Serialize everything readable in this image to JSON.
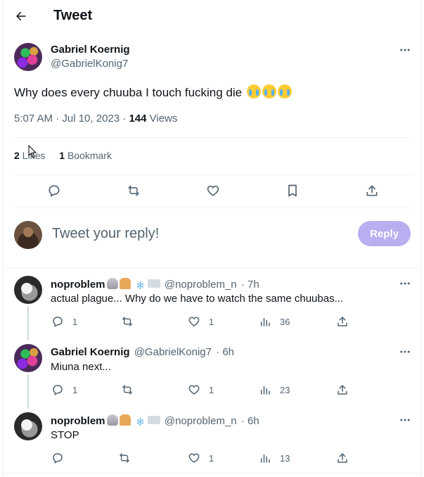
{
  "header": {
    "title": "Tweet"
  },
  "tweet": {
    "author_name": "Gabriel Koernig",
    "author_handle": "@GabrielKonig7",
    "text": "Why does every chuuba I touch fucking die",
    "timestamp": "5:07 AM · Jul 10, 2023 · ",
    "views_count": "144",
    "views_label": " Views",
    "likes_count": "2",
    "likes_label": " Likes",
    "bookmarks_count": "1",
    "bookmarks_label": " Bookmark"
  },
  "composer": {
    "placeholder": "Tweet your reply!",
    "button_label": "Reply"
  },
  "replies": [
    {
      "name": "noproblem",
      "handle": "@noproblem_n",
      "time": " · 7h",
      "text": "actual plague... Why do we have to watch the same chuubas...",
      "reply_count": "1",
      "like_count": "1",
      "views": "36"
    },
    {
      "name": "Gabriel Koernig",
      "handle": "@GabrielKonig7",
      "time": " · 6h",
      "text": "Miuna next...",
      "reply_count": "1",
      "like_count": "1",
      "views": "23"
    },
    {
      "name": "noproblem",
      "handle": "@noproblem_n",
      "time": " · 6h",
      "text": "STOP",
      "reply_count": "",
      "like_count": "1",
      "views": "13"
    }
  ],
  "icons": {
    "back": "arrow-left-icon",
    "more": "more-horizontal-icon",
    "reply": "reply-bubble-icon",
    "retweet": "retweet-icon",
    "like": "heart-icon",
    "bookmark": "bookmark-icon",
    "share": "share-icon",
    "views": "analytics-icon",
    "emoji": "loudly-crying-face-emoji"
  },
  "colors": {
    "accent_disabled": "#b8aef0",
    "text_secondary": "#536471",
    "border": "#eff3f4"
  }
}
